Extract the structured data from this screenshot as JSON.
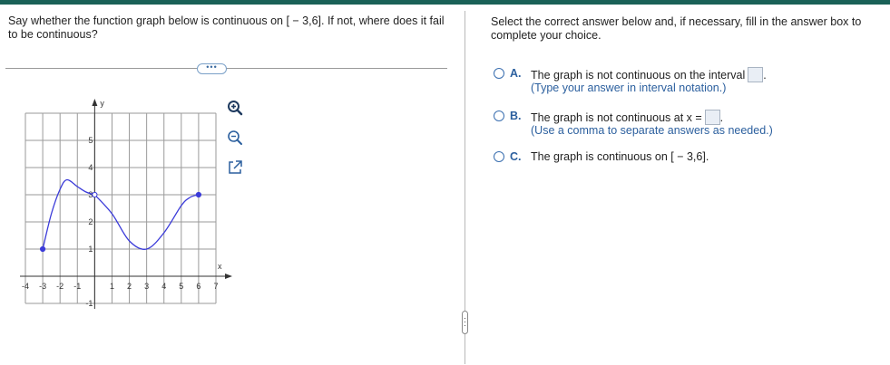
{
  "question": {
    "text": "Say whether the function graph below is continuous on [ − 3,6]. If not, where does it fail to be continuous?"
  },
  "more_button": {
    "label": "•••"
  },
  "graph": {
    "y_axis_label": "y",
    "x_axis_label": "x",
    "x_ticks": [
      "-4",
      "-3",
      "-2",
      "-1",
      "1",
      "2",
      "3",
      "4",
      "5",
      "6",
      "7"
    ],
    "y_ticks": [
      "5",
      "4",
      "3",
      "2",
      "1",
      "-1"
    ],
    "xlim": [
      -4,
      7
    ],
    "ylim": [
      -1,
      6
    ],
    "grid": true,
    "curve_color": "#3b3bd9"
  },
  "chart_data": {
    "type": "line",
    "xlabel": "x",
    "ylabel": "y",
    "xlim": [
      -4,
      7
    ],
    "ylim": [
      -1,
      6
    ],
    "grid": true,
    "series": [
      {
        "x": [
          -3,
          -2.5,
          -2,
          -1.6,
          -1,
          -0.5,
          0
        ],
        "y": [
          1,
          2.3,
          3.2,
          3.55,
          3.3,
          3.1,
          3
        ]
      },
      {
        "x": [
          0,
          1,
          2,
          3,
          4,
          5,
          5.5,
          6
        ],
        "y": [
          3,
          2.3,
          1.3,
          1,
          1.6,
          2.6,
          2.9,
          3
        ]
      }
    ],
    "points": [
      {
        "x": -3,
        "y": 1,
        "filled": true
      },
      {
        "x": 0,
        "y": 3,
        "filled": false
      },
      {
        "x": 6,
        "y": 3,
        "filled": true
      }
    ]
  },
  "tools": {
    "zoom_in": "zoom-in-icon",
    "zoom_out": "zoom-out-icon",
    "open_new": "open-in-new-icon"
  },
  "instructions": {
    "text": "Select the correct answer below and, if necessary, fill in the answer box to complete your choice."
  },
  "options": [
    {
      "letter": "A.",
      "text": "The graph is not continuous on the interval",
      "hint": "(Type your answer in interval notation.)"
    },
    {
      "letter": "B.",
      "text": "The graph is not continuous at x =",
      "hint": "(Use a comma to separate answers as needed.)"
    },
    {
      "letter": "C.",
      "text": "The graph is continuous on [ − 3,6]."
    }
  ],
  "colors": {
    "brand": "#1a6157",
    "accent": "#2b5f9e"
  }
}
